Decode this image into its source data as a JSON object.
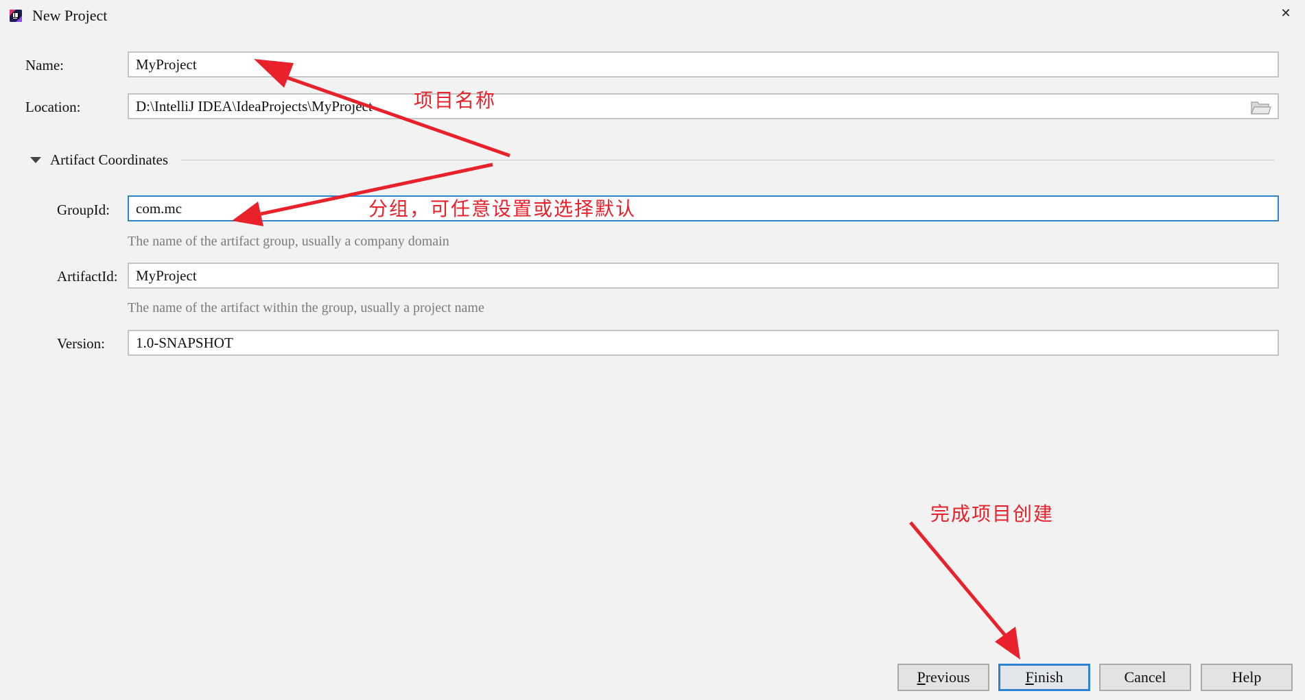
{
  "window": {
    "title": "New Project",
    "close_glyph": "✕",
    "app_icon": "intellij-idea-icon"
  },
  "form": {
    "name": {
      "label": "Name:",
      "value": "MyProject"
    },
    "location": {
      "label": "Location:",
      "value": "D:\\IntelliJ IDEA\\IdeaProjects\\MyProject",
      "icon": "folder-icon"
    },
    "section": {
      "title": "Artifact Coordinates",
      "state": "expanded"
    },
    "group_id": {
      "label": "GroupId:",
      "value": "com.mc",
      "hint": "The name of the artifact group, usually a company domain"
    },
    "artifact_id": {
      "label": "ArtifactId:",
      "value": "MyProject",
      "hint": "The name of the artifact within the group, usually a project name"
    },
    "version": {
      "label": "Version:",
      "value": "1.0-SNAPSHOT"
    }
  },
  "buttons": {
    "previous": {
      "mnemonic": "P",
      "rest": "revious"
    },
    "finish": {
      "mnemonic": "F",
      "rest": "inish"
    },
    "cancel": "Cancel",
    "help": "Help"
  },
  "annotations": {
    "project_name": "项目名称",
    "group_note": "分组，可任意设置或选择默认",
    "finish_note": "完成项目创建",
    "color": "#e8212a"
  },
  "colors": {
    "background": "#f2f2f2",
    "focus_border": "#2d82d4",
    "hint_text": "#7b7b7b"
  }
}
